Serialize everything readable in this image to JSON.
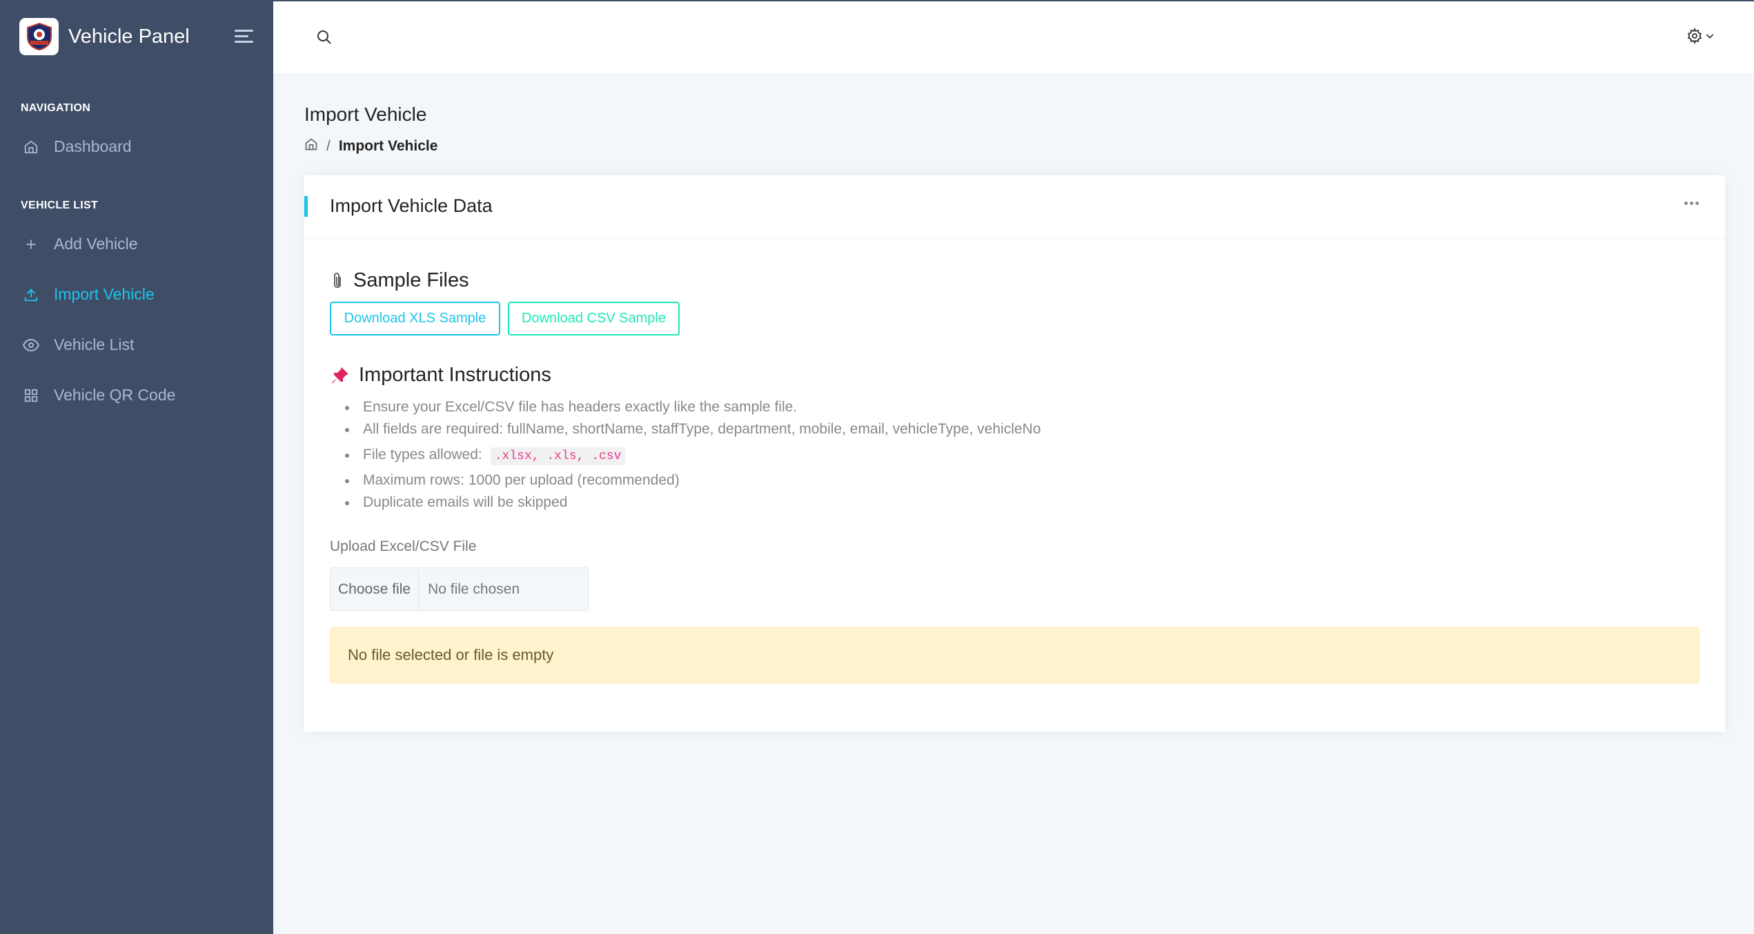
{
  "sidebar": {
    "brand_title": "Vehicle Panel",
    "sections": [
      {
        "caption": "NAVIGATION",
        "items": [
          {
            "label": "Dashboard",
            "icon": "home-icon"
          }
        ]
      },
      {
        "caption": "VEHICLE LIST",
        "items": [
          {
            "label": "Add Vehicle",
            "icon": "plus-icon"
          },
          {
            "label": "Import Vehicle",
            "icon": "upload-icon",
            "active": true
          },
          {
            "label": "Vehicle List",
            "icon": "eye-icon"
          },
          {
            "label": "Vehicle QR Code",
            "icon": "grid-icon"
          }
        ]
      }
    ]
  },
  "header": {
    "search_icon": "search-icon",
    "settings_icon": "gear-icon"
  },
  "page": {
    "title": "Import Vehicle",
    "breadcrumb": {
      "separator": "/",
      "current": "Import Vehicle"
    }
  },
  "card": {
    "title": "Import Vehicle Data",
    "sample_title": "Sample Files",
    "download_xls": "Download XLS Sample",
    "download_csv": "Download CSV Sample",
    "instructions_title": "Important Instructions",
    "instructions": [
      "Ensure your Excel/CSV file has headers exactly like the sample file.",
      "All fields are required: fullName, shortName, staffType, department, mobile, email, vehicleType, vehicleNo",
      "File types allowed:",
      "Maximum rows: 1000 per upload (recommended)",
      "Duplicate emails will be skipped"
    ],
    "file_types_code": ".xlsx, .xls, .csv",
    "upload_label": "Upload Excel/CSV File",
    "choose_file": "Choose file",
    "no_file": "No file chosen",
    "alert": "No file selected or file is empty"
  },
  "colors": {
    "sidebar_bg": "#3f4d67",
    "accent": "#1dc4e9",
    "accent_green": "#1de9b6",
    "alert_bg": "#fff3cd"
  }
}
